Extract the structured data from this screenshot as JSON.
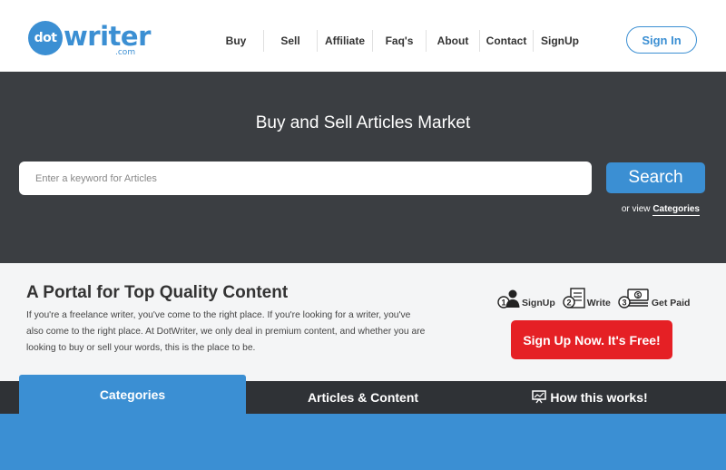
{
  "header": {
    "logo": {
      "dot": "dot",
      "word": "writer",
      "com": ".com"
    },
    "nav": [
      {
        "label": "Buy"
      },
      {
        "label": "Sell"
      },
      {
        "label": "Affiliate"
      },
      {
        "label": "Faq's"
      },
      {
        "label": "About"
      },
      {
        "label": "Contact"
      },
      {
        "label": "SignUp"
      }
    ],
    "signin_label": "Sign In"
  },
  "hero": {
    "title": "Buy and Sell Articles Market",
    "search_placeholder": "Enter a keyword for Articles",
    "search_button": "Search",
    "view_prefix": "or view",
    "view_link": "Categories"
  },
  "portal": {
    "title": "A Portal for Top Quality Content",
    "text": "If you're a freelance writer, you've come to the right place. If you're looking for a writer, you've also come to the right place. At DotWriter, we only deal in premium content, and whether you are looking to buy or sell your words, this is the place to be.",
    "steps": [
      {
        "number": "1",
        "label": "SignUp",
        "icon": "user-icon"
      },
      {
        "number": "2",
        "label": "Write",
        "icon": "document-icon"
      },
      {
        "number": "3",
        "label": "Get Paid",
        "icon": "money-icon"
      }
    ],
    "cta": "Sign Up Now. It's Free!"
  },
  "tabs": [
    {
      "label": "Categories",
      "active": true
    },
    {
      "label": "Articles & Content",
      "active": false
    },
    {
      "label": "How this works!",
      "active": false,
      "icon": "presentation-icon"
    }
  ],
  "colors": {
    "brand_blue": "#3b8fd3",
    "hero_dark": "#3b3e42",
    "tab_bar": "#2f3236",
    "cta_red": "#e52025"
  }
}
